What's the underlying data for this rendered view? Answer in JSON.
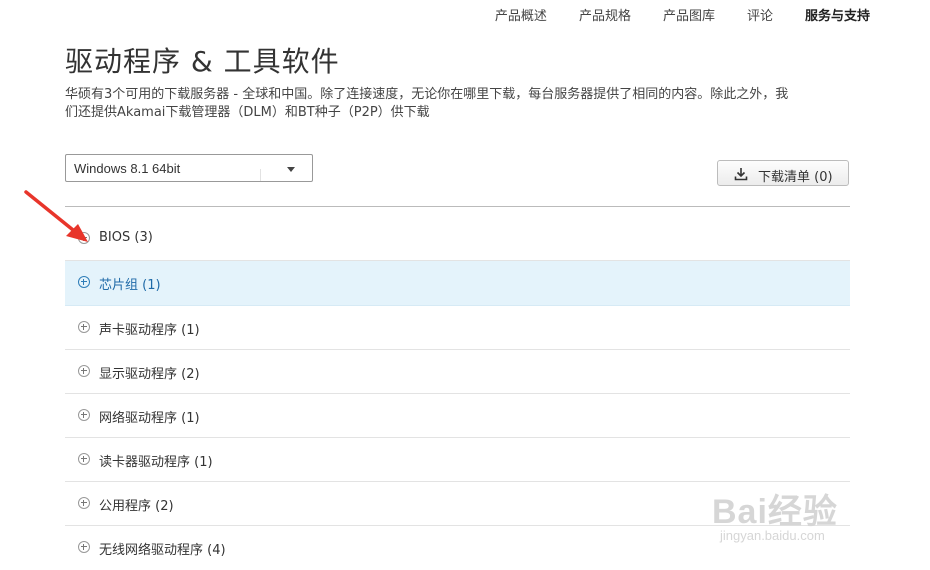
{
  "topnav": {
    "items": [
      "产品概述",
      "产品规格",
      "产品图库",
      "评论",
      "服务与支持"
    ],
    "active_index": 4
  },
  "page": {
    "title": "驱动程序 & 工具软件",
    "intro_line1": "华硕有3个可用的下载服务器 - 全球和中国。除了连接速度，无论你在哪里下载，每台服务器提供了相同的内容。除此之外，我",
    "intro_line2": "们还提供Akamai下载管理器（DLM）和BT种子（P2P）供下载"
  },
  "os_select": {
    "value": "Windows 8.1 64bit"
  },
  "download_list_button": {
    "label": "下载清单 (0)"
  },
  "categories": [
    {
      "label": "BIOS (3)",
      "highlighted": false
    },
    {
      "label": "芯片组 (1)",
      "highlighted": true
    },
    {
      "label": "声卡驱动程序 (1)",
      "highlighted": false
    },
    {
      "label": "显示驱动程序 (2)",
      "highlighted": false
    },
    {
      "label": "网络驱动程序 (1)",
      "highlighted": false
    },
    {
      "label": "读卡器驱动程序 (1)",
      "highlighted": false
    },
    {
      "label": "公用程序 (2)",
      "highlighted": false
    },
    {
      "label": "无线网络驱动程序 (4)",
      "highlighted": false
    }
  ],
  "watermark": {
    "brand": "Bai经验",
    "url": "jingyan.baidu.com"
  },
  "colors": {
    "highlight_bg": "#e4f3fb",
    "highlight_text": "#1f6aa8",
    "arrow": "#e8352b"
  }
}
